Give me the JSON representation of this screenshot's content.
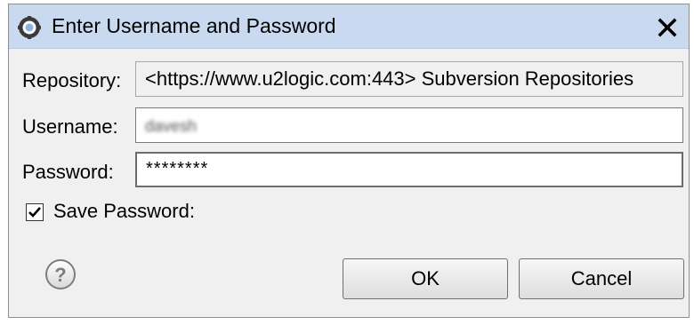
{
  "window": {
    "title": "Enter Username and Password",
    "title_icon": "svn-gear-icon",
    "close_icon": "close-icon"
  },
  "form": {
    "repository_label": "Repository:",
    "repository_value": "<https://www.u2logic.com:443> Subversion Repositories",
    "username_label": "Username:",
    "username_value": "davesh",
    "password_label": "Password:",
    "password_value": "********"
  },
  "save_password": {
    "label": "Save Password:",
    "checked": true
  },
  "buttons": {
    "ok_label": "OK",
    "cancel_label": "Cancel",
    "help_icon": "help-icon"
  },
  "colors": {
    "titlebar": "#c9daf0",
    "dialog_bg": "#f0f0f0"
  }
}
